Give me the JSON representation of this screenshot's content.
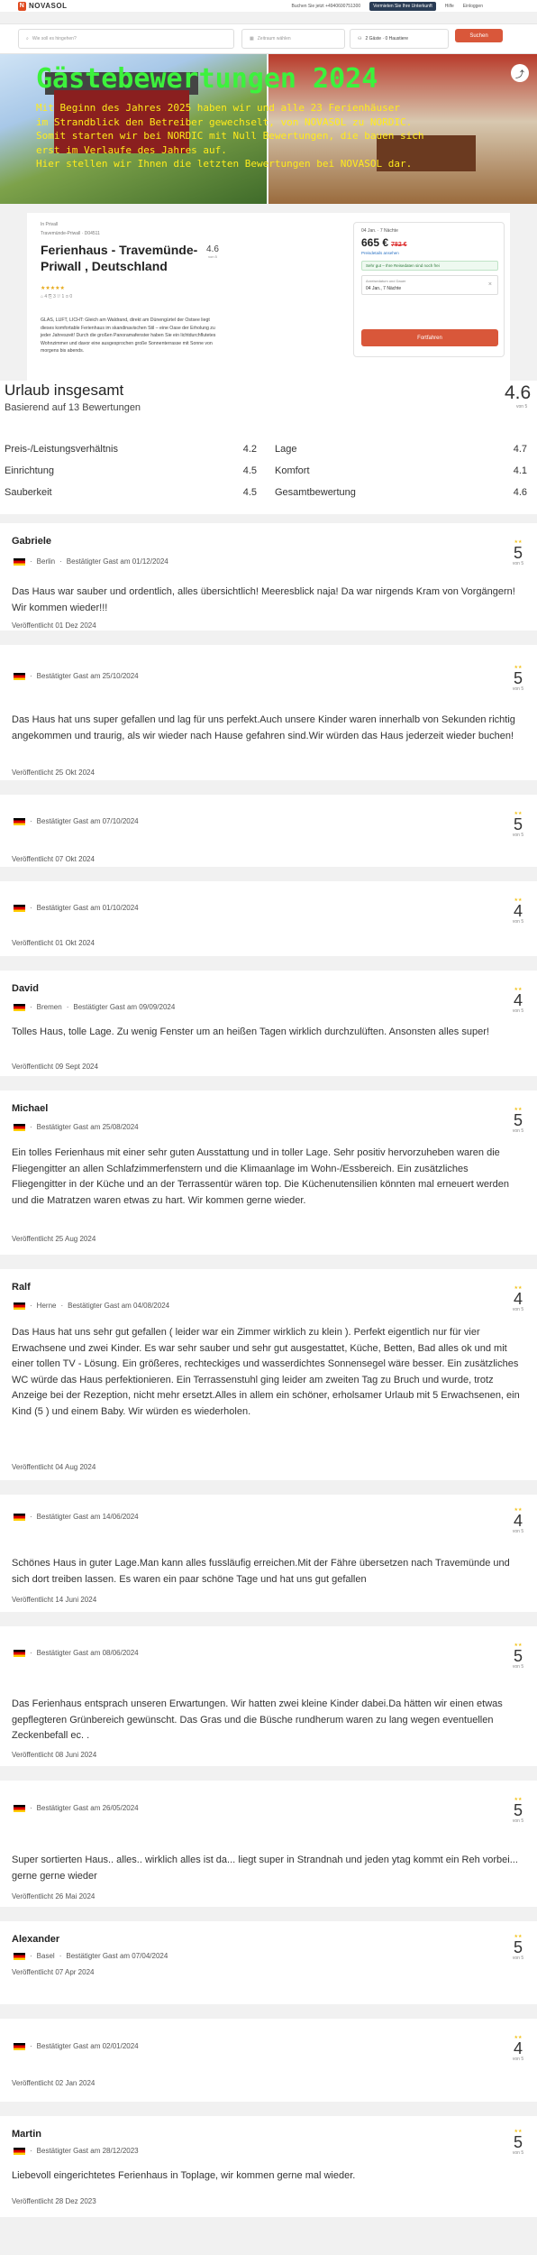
{
  "topbar": {
    "logo": "NOVASOL",
    "links": [
      "Buchen Sie jetzt +4940600751300",
      "Vermieten Sie Ihre Unterkunft",
      "Hilfe",
      "Einloggen"
    ]
  },
  "search": {
    "destination_placeholder": "Wie soll es hingehen?",
    "dates_placeholder": "Zeitraum wählen",
    "guests_value": "2 Gäste · 0 Haustiere",
    "button": "Suchen"
  },
  "hero": {
    "title": "Gästebewertungen 2024",
    "lines": [
      "Mit Beginn des Jahres 2025 haben wir und alle 23 Ferienhäuser",
      "im Strandblick den Betreiber gewechselt, von NOVASOL zu NORDIC.",
      "Somit starten wir bei NORDIC mit Null Bewertungen, die bauen sich",
      "erst im Verlaufe des Jahres auf.",
      "Hier stellen wir Ihnen die letzten Bewertungen bei NOVASOL dar."
    ]
  },
  "property": {
    "crumb": "In Privall",
    "crumb2": "Travemünde-Priwall · D04511",
    "title": "Ferienhaus - Travemünde-Priwall , Deutschland",
    "rating": "4.6",
    "rating_sub": "von 5",
    "stars": "★★★★★",
    "meta": "⌂ 4   ⎘ 3   ⛆ 1   ⊙ 0",
    "description": "GLAS, LUFT, LICHT: Gleich am Waldrand, direkt am Dünengürtel der Ostsee liegt dieses komfortable Ferienhaus im skandinavischen Stil – eine Oase der Erholung zu jeder Jahreszeit! Durch die großen Panoramafenster haben Sie ein lichtdurchflutetes Wohnzimmer und davor eine ausgesprochen große Sonnenterrasse mit Sonne von morgens bis abends."
  },
  "booking": {
    "dates": "04 Jan. · 7 Nächte",
    "price": "665 €",
    "old_price": "782 €",
    "details_link": "Preisdetails ansehen",
    "note": "Sehr gut – Ihre Reisedaten sind noch frei",
    "field_label": "Anreisedatum und Dauer",
    "field_value": "04 Jan., 7 Nächte",
    "button": "Fortfahren"
  },
  "summary": {
    "title": "Urlaub insgesamt",
    "subtitle": "Basierend auf 13 Bewertungen",
    "score": "4.6",
    "score_sub": "von 5",
    "categories": [
      {
        "label": "Preis-/Leistungsverhältnis",
        "value": "4.2"
      },
      {
        "label": "Lage",
        "value": "4.7"
      },
      {
        "label": "Einrichtung",
        "value": "4.5"
      },
      {
        "label": "Komfort",
        "value": "4.1"
      },
      {
        "label": "Sauberkeit",
        "value": "4.5"
      },
      {
        "label": "Gesamtbewertung",
        "value": "4.6"
      }
    ]
  },
  "reviews": [
    {
      "name": "Gabriele",
      "city": "Berlin",
      "verified": "Bestätigter Gast am 01/12/2024",
      "text": "Das Haus war sauber und ordentlich, alles übersichtlich! Meeresblick naja! Da war nirgends Kram von Vorgängern! Wir kommen wieder!!!",
      "published": "Veröffentlicht 01 Dez 2024",
      "score": "5",
      "of": "von 5"
    },
    {
      "name": "",
      "city": "",
      "verified": "Bestätigter Gast am 25/10/2024",
      "text": "Das Haus hat uns super gefallen und lag für uns perfekt.Auch unsere Kinder waren innerhalb von Sekunden richtig angekommen und traurig, als wir wieder nach Hause gefahren sind.Wir würden das Haus jederzeit wieder buchen!",
      "published": "Veröffentlicht 25 Okt 2024",
      "score": "5",
      "of": "von 5"
    },
    {
      "name": "",
      "city": "",
      "verified": "Bestätigter Gast am 07/10/2024",
      "text": "",
      "published": "Veröffentlicht 07 Okt 2024",
      "score": "5",
      "of": "von 5"
    },
    {
      "name": "",
      "city": "",
      "verified": "Bestätigter Gast am 01/10/2024",
      "text": "",
      "published": "Veröffentlicht 01 Okt 2024",
      "score": "4",
      "of": "von 5"
    },
    {
      "name": "David",
      "city": "Bremen",
      "verified": "Bestätigter Gast am 09/09/2024",
      "text": "Tolles Haus, tolle Lage. Zu wenig Fenster um an heißen Tagen wirklich durchzulüften. Ansonsten alles super!",
      "published": "Veröffentlicht 09 Sept 2024",
      "score": "4",
      "of": "von 5"
    },
    {
      "name": "Michael",
      "city": "",
      "verified": "Bestätigter Gast am 25/08/2024",
      "text": "Ein tolles Ferienhaus mit einer sehr guten Ausstattung und in toller Lage. Sehr positiv hervorzuheben waren die Fliegengitter an allen Schlafzimmerfenstern und die Klimaanlage im Wohn-/Essbereich. Ein zusätzliches Fliegengitter in der Küche und an der Terrassentür wären top. Die Küchenutensilien könnten mal erneuert werden und die Matratzen waren etwas zu hart. Wir kommen gerne wieder.",
      "published": "Veröffentlicht 25 Aug 2024",
      "score": "5",
      "of": "von 5"
    },
    {
      "name": "Ralf",
      "city": "Herne",
      "verified": "Bestätigter Gast am 04/08/2024",
      "text": "Das Haus hat uns sehr gut gefallen ( leider war ein Zimmer wirklich zu klein ). Perfekt eigentlich nur für vier Erwachsene und zwei Kinder. Es war sehr sauber und sehr gut ausgestattet, Küche, Betten, Bad alles ok und mit einer tollen TV - Lösung. Ein größeres, rechteckiges und wasserdichtes Sonnensegel wäre besser. Ein zusätzliches WC würde das Haus perfektionieren. Ein Terrassenstuhl ging leider am zweiten Tag zu Bruch und wurde, trotz Anzeige bei der Rezeption, nicht mehr ersetzt.Alles in allem ein schöner, erholsamer Urlaub mit 5 Erwachsenen, ein Kind (5 ) und einem Baby. Wir würden es wiederholen.",
      "published": "Veröffentlicht 04 Aug 2024",
      "score": "4",
      "of": "von 5"
    },
    {
      "name": "",
      "city": "",
      "verified": "Bestätigter Gast am 14/06/2024",
      "text": "Schönes Haus in guter Lage.Man kann alles fussläufig erreichen.Mit der Fähre übersetzen nach Travemünde und sich dort treiben lassen. Es waren ein paar schöne Tage und hat uns gut gefallen",
      "published": "Veröffentlicht 14 Juni 2024",
      "score": "4",
      "of": "von 5"
    },
    {
      "name": "",
      "city": "",
      "verified": "Bestätigter Gast am 08/06/2024",
      "text": "Das Ferienhaus entsprach unseren Erwartungen. Wir hatten zwei kleine Kinder dabei.Da hätten wir einen etwas gepflegteren Grünbereich gewünscht. Das Gras und die Büsche rundherum waren zu lang wegen eventuellen Zeckenbefall ec. .",
      "published": "Veröffentlicht 08 Juni 2024",
      "score": "5",
      "of": "von 5"
    },
    {
      "name": "",
      "city": "",
      "verified": "Bestätigter Gast am 26/05/2024",
      "text": "Super sortierten Haus.. alles.. wirklich alles ist da... liegt super in Strandnah und jeden ytag kommt ein Reh vorbei... gerne gerne wieder",
      "published": "Veröffentlicht 26 Mai 2024",
      "score": "5",
      "of": "von 5"
    },
    {
      "name": "Alexander",
      "city": "Basel",
      "verified": "Bestätigter Gast am 07/04/2024",
      "text": "",
      "published": "Veröffentlicht 07 Apr 2024",
      "score": "5",
      "of": "von 5"
    },
    {
      "name": "",
      "city": "",
      "verified": "Bestätigter Gast am 02/01/2024",
      "text": "",
      "published": "Veröffentlicht 02 Jan 2024",
      "score": "4",
      "of": "von 5"
    },
    {
      "name": "Martin",
      "city": "",
      "verified": "Bestätigter Gast am 28/12/2023",
      "text": "Liebevoll eingerichtetes Ferienhaus in Toplage, wir kommen gerne mal wieder.",
      "published": "Veröffentlicht 28 Dez 2023",
      "score": "5",
      "of": "von 5"
    }
  ]
}
